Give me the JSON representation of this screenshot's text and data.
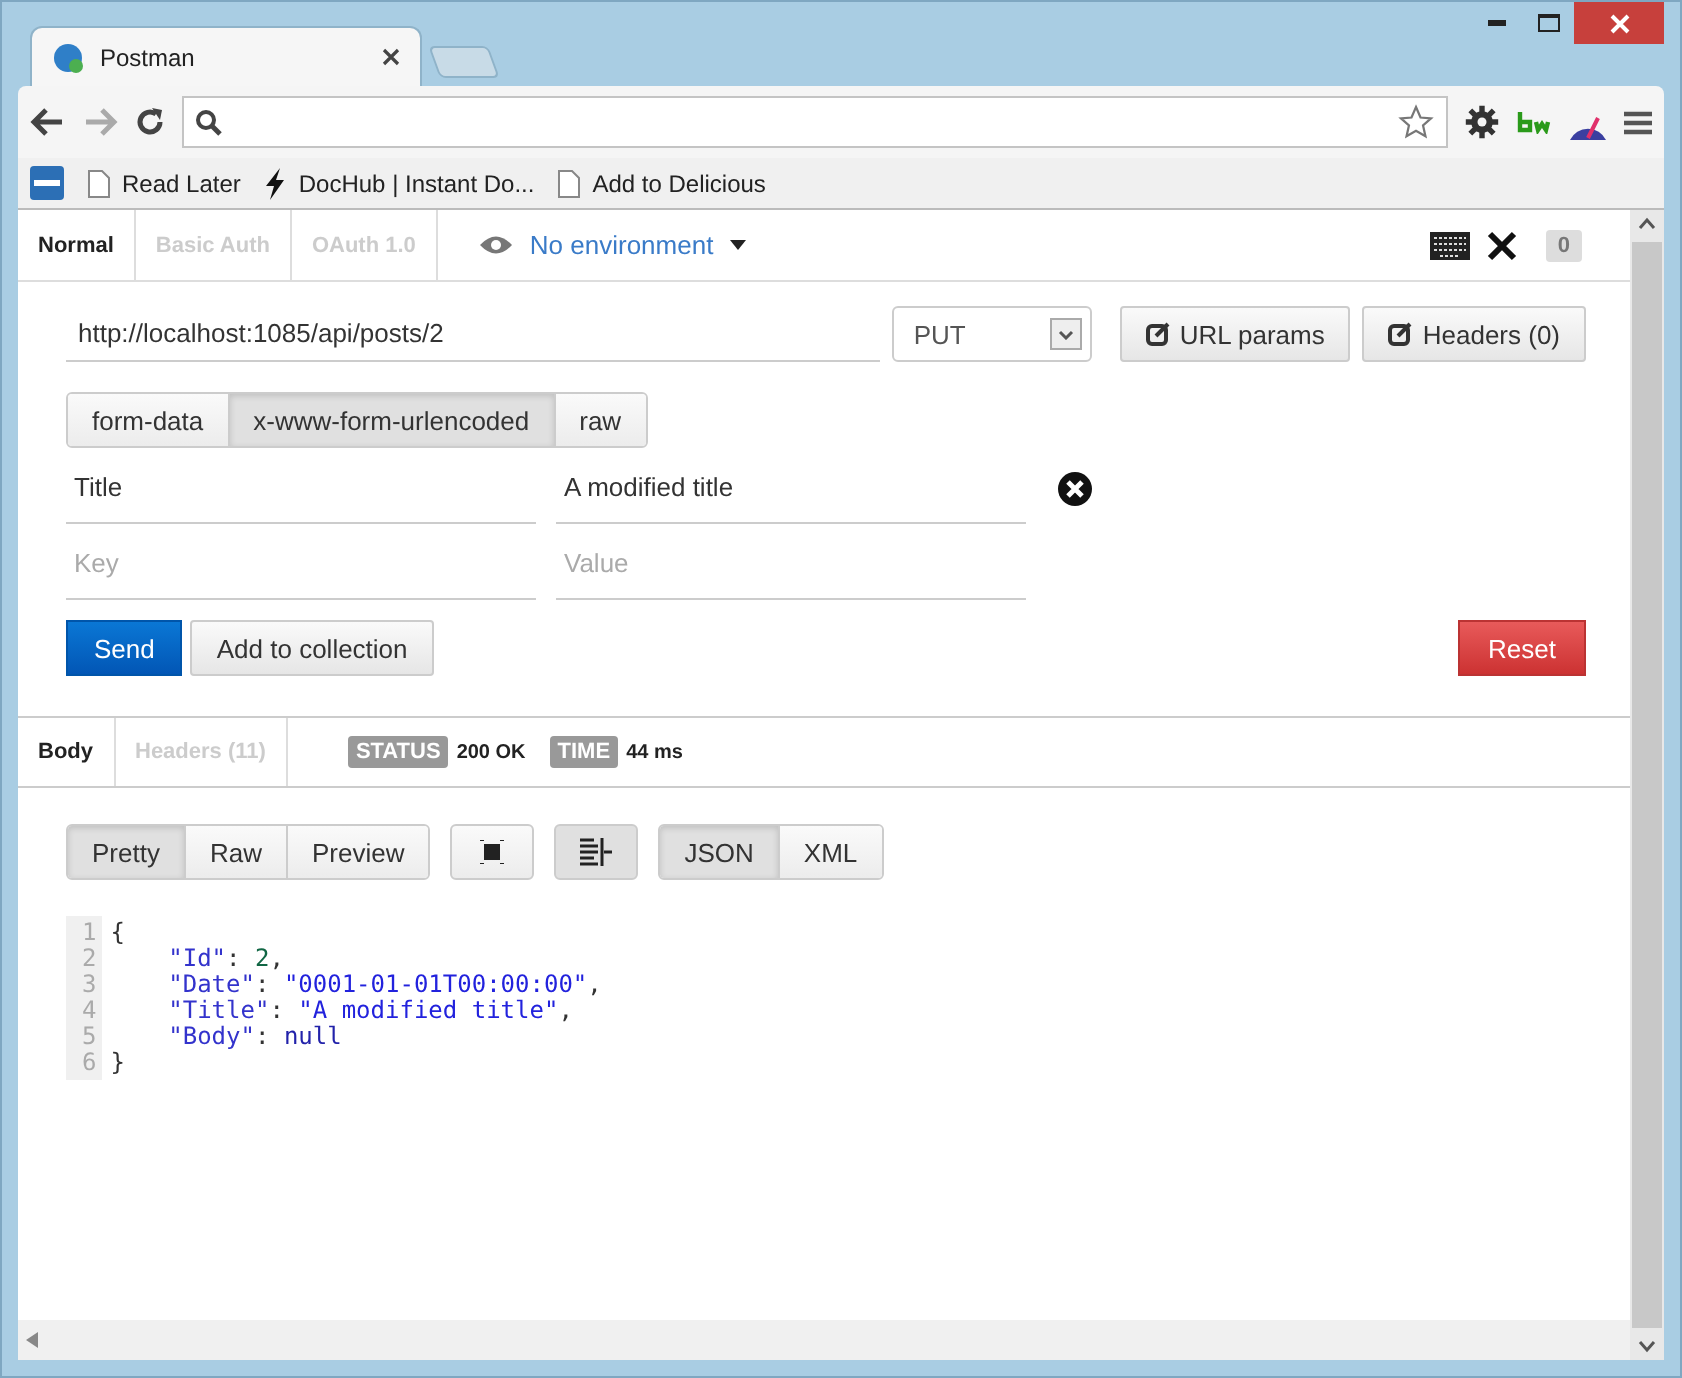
{
  "browser": {
    "tab_title": "Postman",
    "bookmarks": [
      {
        "kind": "page",
        "label": "Read Later"
      },
      {
        "kind": "bolt",
        "label": "DocHub | Instant Do..."
      },
      {
        "kind": "page",
        "label": "Add to Delicious"
      }
    ]
  },
  "auth_tabs": [
    {
      "label": "Normal",
      "selected": true
    },
    {
      "label": "Basic Auth",
      "selected": false
    },
    {
      "label": "OAuth 1.0",
      "selected": false
    }
  ],
  "environment": "No environment",
  "history_count": "0",
  "request": {
    "url": "http://localhost:1085/api/posts/2",
    "method": "PUT",
    "buttons": [
      "URL params",
      "Headers (0)"
    ]
  },
  "body_modes": [
    {
      "label": "form-data",
      "selected": false
    },
    {
      "label": "x-www-form-urlencoded",
      "selected": true
    },
    {
      "label": "raw",
      "selected": false
    }
  ],
  "params": [
    {
      "key": "Title",
      "value": "A modified title"
    }
  ],
  "new_param": {
    "key_placeholder": "Key",
    "value_placeholder": "Value"
  },
  "actions": {
    "send": "Send",
    "add": "Add to collection",
    "reset": "Reset"
  },
  "response_tabs": [
    {
      "label": "Body",
      "selected": true
    },
    {
      "label": "Headers (11)",
      "selected": false
    }
  ],
  "status": {
    "label": "STATUS",
    "value": "200 OK"
  },
  "time": {
    "label": "TIME",
    "value": "44 ms"
  },
  "view_modes": [
    {
      "label": "Pretty",
      "selected": true
    },
    {
      "label": "Raw",
      "selected": false
    },
    {
      "label": "Preview",
      "selected": false
    }
  ],
  "wrap_selected": true,
  "formats": [
    {
      "label": "JSON",
      "selected": true
    },
    {
      "label": "XML",
      "selected": false
    }
  ],
  "code": [
    {
      "number": "1",
      "indented": false,
      "tokens": [
        {
          "kind": "punct",
          "text": "{"
        }
      ]
    },
    {
      "number": "2",
      "indented": true,
      "tokens": [
        {
          "kind": "key",
          "text": "\"Id\""
        },
        {
          "kind": "punct",
          "text": ": "
        },
        {
          "kind": "number",
          "text": "2"
        },
        {
          "kind": "punct",
          "text": ","
        }
      ]
    },
    {
      "number": "3",
      "indented": true,
      "tokens": [
        {
          "kind": "key",
          "text": "\"Date\""
        },
        {
          "kind": "punct",
          "text": ": "
        },
        {
          "kind": "string",
          "text": "\"0001-01-01T00:00:00\""
        },
        {
          "kind": "punct",
          "text": ","
        }
      ]
    },
    {
      "number": "4",
      "indented": true,
      "tokens": [
        {
          "kind": "key",
          "text": "\"Title\""
        },
        {
          "kind": "punct",
          "text": ": "
        },
        {
          "kind": "string",
          "text": "\"A modified title\""
        },
        {
          "kind": "punct",
          "text": ","
        }
      ]
    },
    {
      "number": "5",
      "indented": true,
      "tokens": [
        {
          "kind": "key",
          "text": "\"Body\""
        },
        {
          "kind": "punct",
          "text": ": "
        },
        {
          "kind": "null",
          "text": "null"
        }
      ]
    },
    {
      "number": "6",
      "indented": false,
      "tokens": [
        {
          "kind": "punct",
          "text": "}"
        }
      ]
    }
  ]
}
